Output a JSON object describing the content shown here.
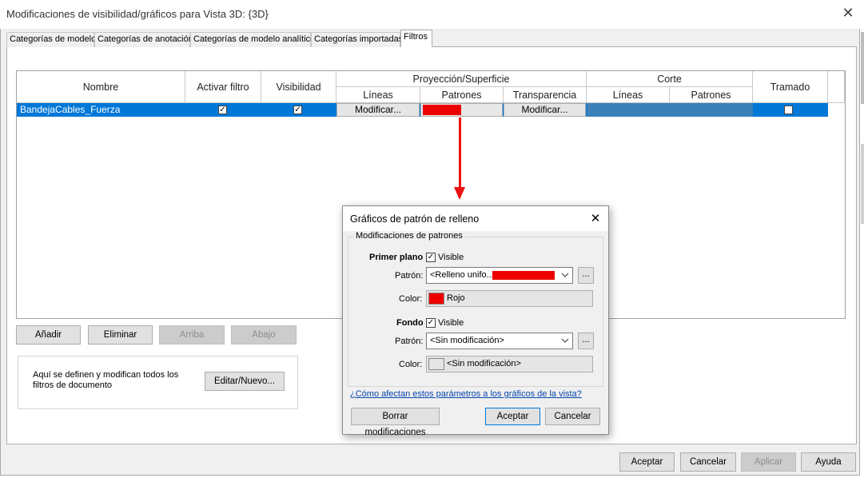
{
  "window": {
    "title": "Modificaciones de visibilidad/gráficos para Vista 3D: {3D}",
    "close_glyph": "✕"
  },
  "tabs": [
    {
      "label": "Categorías de modelo"
    },
    {
      "label": "Categorías de anotación"
    },
    {
      "label": "Categorías de modelo analítico"
    },
    {
      "label": "Categorías importadas"
    },
    {
      "label": "Filtros",
      "active": true
    }
  ],
  "grid": {
    "headers": {
      "nombre": "Nombre",
      "activar": "Activar filtro",
      "visibilidad": "Visibilidad",
      "proyeccion": "Proyección/Superficie",
      "proy_lineas": "Líneas",
      "proy_patrones": "Patrones",
      "proy_transparencia": "Transparencia",
      "corte": "Corte",
      "corte_lineas": "Líneas",
      "corte_patrones": "Patrones",
      "tramado": "Tramado"
    },
    "rows": [
      {
        "nombre": "BandejaCables_Fuerza",
        "activar_filtro": true,
        "visibilidad": true,
        "proy_lineas": "Modificar...",
        "proy_patrones_color": "#ee0000",
        "proy_transparencia": "Modificar...",
        "tramado": false
      }
    ],
    "selection_color": "#0078d7"
  },
  "buttons": {
    "anadir": "Añadir",
    "eliminar": "Eliminar",
    "arriba": "Arriba",
    "abajo": "Abajo",
    "editar_nuevo": "Editar/Nuevo...",
    "aceptar": "Aceptar",
    "cancelar": "Cancelar",
    "aplicar": "Aplicar",
    "ayuda": "Ayuda"
  },
  "info_text_line1": "Aquí se definen y modifican todos los",
  "info_text_line2": "filtros de documento",
  "checkmark": "✓",
  "dialog": {
    "title": "Gráficos de patrón de relleno",
    "close_glyph": "✕",
    "group_label": "Modificaciones de patrones",
    "foreground": {
      "label": "Primer plano",
      "visible_label": "Visible",
      "visible": true,
      "pattern_label": "Patrón:",
      "pattern_value": "<Relleno unifo...",
      "pattern_swatch": "#ee0000",
      "color_label": "Color:",
      "color_value": "Rojo",
      "color_swatch": "#ee0000"
    },
    "background": {
      "label": "Fondo",
      "visible_label": "Visible",
      "visible": true,
      "pattern_label": "Patrón:",
      "pattern_value": "<Sin modificación>",
      "color_label": "Color:",
      "color_value": "<Sin modificación>",
      "color_swatch": "#e5e5e5"
    },
    "ellipsis": "...",
    "help_link": "¿Cómo afectan estos parámetros a los gráficos de la vista?",
    "buttons": {
      "borrar": "Borrar modificaciones",
      "aceptar": "Aceptar",
      "cancelar": "Cancelar"
    }
  },
  "colors": {
    "accent": "#0078d7",
    "arrow": "#ee1111"
  }
}
